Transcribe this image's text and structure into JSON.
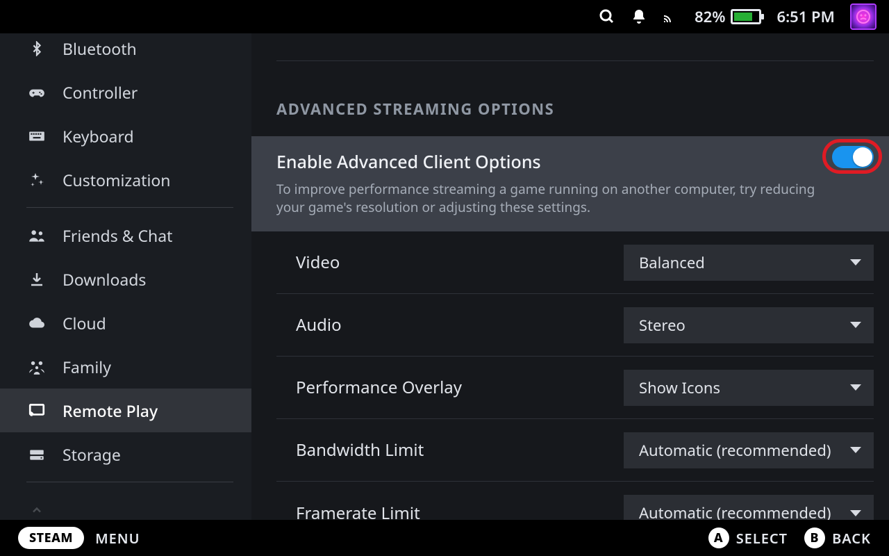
{
  "status": {
    "battery_percent": "82%",
    "clock": "6:51 PM"
  },
  "sidebar": {
    "items": [
      {
        "id": "bluetooth",
        "label": "Bluetooth"
      },
      {
        "id": "controller",
        "label": "Controller"
      },
      {
        "id": "keyboard",
        "label": "Keyboard"
      },
      {
        "id": "customization",
        "label": "Customization"
      },
      {
        "id": "friends",
        "label": "Friends & Chat"
      },
      {
        "id": "downloads",
        "label": "Downloads"
      },
      {
        "id": "cloud",
        "label": "Cloud"
      },
      {
        "id": "family",
        "label": "Family"
      },
      {
        "id": "remoteplay",
        "label": "Remote Play",
        "selected": true
      },
      {
        "id": "storage",
        "label": "Storage"
      }
    ]
  },
  "section": {
    "title": "ADVANCED STREAMING OPTIONS",
    "toggle": {
      "label": "Enable Advanced Client Options",
      "description": "To improve performance streaming a game running on another computer, try reducing your game's resolution or adjusting these settings.",
      "value": true
    },
    "rows": [
      {
        "id": "video",
        "label": "Video",
        "value": "Balanced"
      },
      {
        "id": "audio",
        "label": "Audio",
        "value": "Stereo"
      },
      {
        "id": "overlay",
        "label": "Performance Overlay",
        "value": "Show Icons"
      },
      {
        "id": "bandwidth",
        "label": "Bandwidth Limit",
        "value": "Automatic (recommended)"
      },
      {
        "id": "framerate",
        "label": "Framerate Limit",
        "value": "Automatic (recommended)"
      }
    ]
  },
  "footer": {
    "steam": "STEAM",
    "menu": "MENU",
    "a_label": "SELECT",
    "b_label": "BACK",
    "a_glyph": "A",
    "b_glyph": "B"
  }
}
